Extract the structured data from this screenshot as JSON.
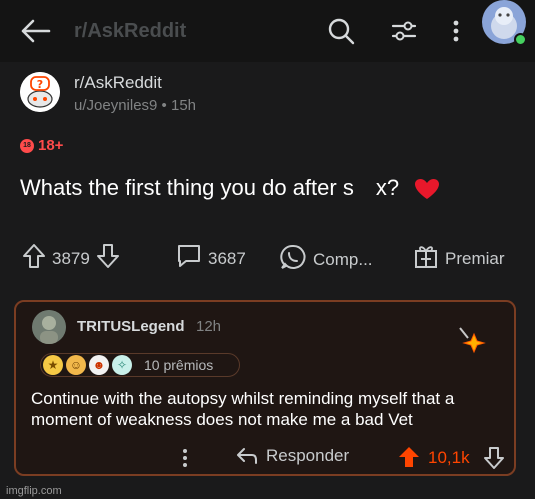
{
  "header": {
    "title": "r/AskReddit",
    "back_icon": "back-arrow-icon",
    "search_icon": "search-icon",
    "filter_icon": "filter-icon",
    "more_icon": "more-vertical-icon"
  },
  "post": {
    "subreddit": "r/AskReddit",
    "author_meta": "u/Joeyniles9 • 15h",
    "nsfw_label": "18+",
    "nsfw_badge_text": "18",
    "title_start": "Whats the first thing you do after s",
    "title_end": "x?",
    "upvotes": "3879",
    "comments": "3687",
    "share_label": "Comp...",
    "award_label": "Premiar"
  },
  "comment": {
    "author": "TRITUSLegend",
    "time": "12h",
    "awards_count": "10 prêmios",
    "body": "Continue with the autopsy whilst reminding myself that a moment of weakness does not make me a bad Vet",
    "reply_label": "Responder",
    "score": "10,1k"
  },
  "watermark": "imgflip.com",
  "colors": {
    "background": "#1a1a1b",
    "topbar": "#141414",
    "nsfw": "#ff4b4b",
    "comment_border": "#7b3d22",
    "upvote_active": "#ff4500"
  }
}
